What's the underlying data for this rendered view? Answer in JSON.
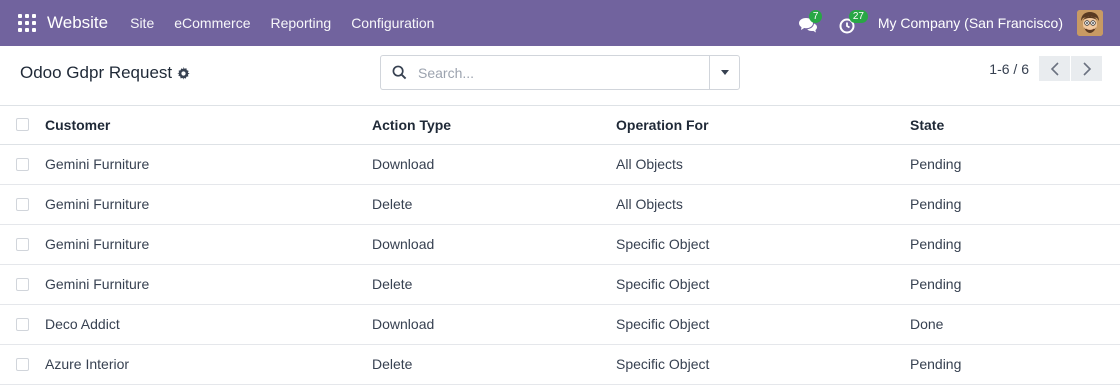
{
  "navbar": {
    "brand": "Website",
    "menu": [
      "Site",
      "eCommerce",
      "Reporting",
      "Configuration"
    ],
    "messages_count": "7",
    "activities_count": "27",
    "company": "My Company (San Francisco)",
    "color": "#71639e"
  },
  "control_panel": {
    "title": "Odoo Gdpr Request",
    "search_placeholder": "Search...",
    "pager_value": "1-6 / 6"
  },
  "table": {
    "headers": {
      "customer": "Customer",
      "action_type": "Action Type",
      "operation_for": "Operation For",
      "state": "State"
    },
    "rows": [
      {
        "customer": "Gemini Furniture",
        "action_type": "Download",
        "operation_for": "All Objects",
        "state": "Pending"
      },
      {
        "customer": "Gemini Furniture",
        "action_type": "Delete",
        "operation_for": "All Objects",
        "state": "Pending"
      },
      {
        "customer": "Gemini Furniture",
        "action_type": "Download",
        "operation_for": "Specific Object",
        "state": "Pending"
      },
      {
        "customer": "Gemini Furniture",
        "action_type": "Delete",
        "operation_for": "Specific Object",
        "state": "Pending"
      },
      {
        "customer": "Deco Addict",
        "action_type": "Download",
        "operation_for": "Specific Object",
        "state": "Done"
      },
      {
        "customer": "Azure Interior",
        "action_type": "Delete",
        "operation_for": "Specific Object",
        "state": "Pending"
      }
    ]
  }
}
